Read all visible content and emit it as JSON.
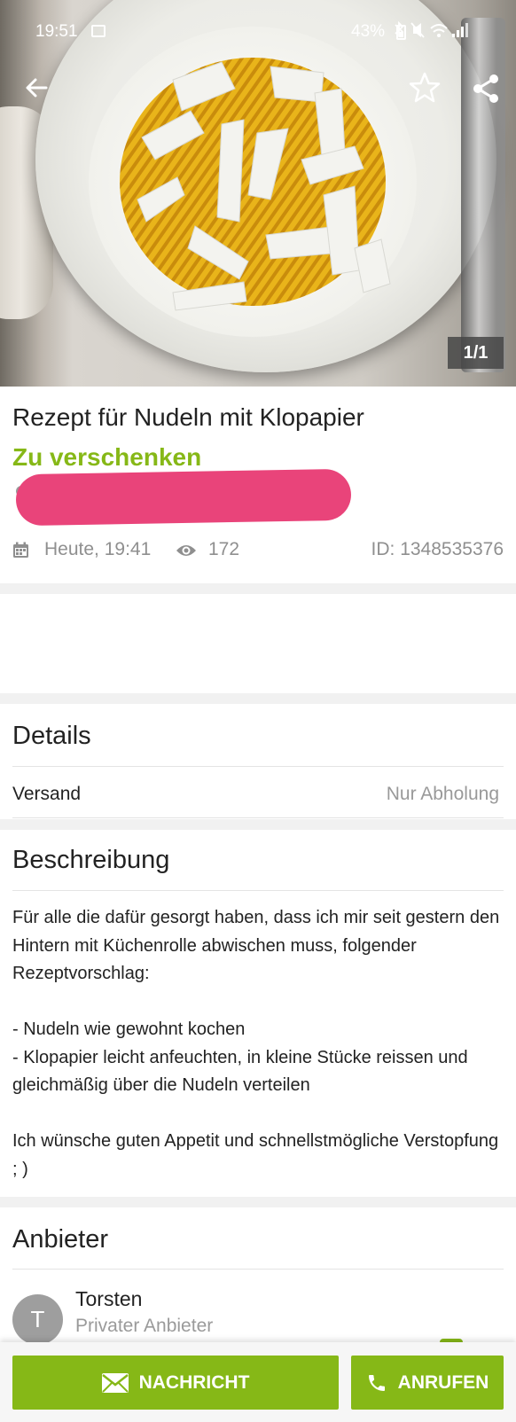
{
  "status_bar": {
    "time": "19:51",
    "battery": "43%"
  },
  "gallery": {
    "counter": "1/1"
  },
  "listing": {
    "title": "Rezept für Nudeln mit Klopapier",
    "price": "Zu verschenken",
    "date": "Heute, 19:41",
    "views": "172",
    "id": "ID: 1348535376"
  },
  "details": {
    "heading": "Details",
    "rows": [
      {
        "label": "Versand",
        "value": "Nur Abholung"
      }
    ]
  },
  "description": {
    "heading": "Beschreibung",
    "text": "Für alle die dafür gesorgt haben, dass ich mir seit gestern den Hintern mit Küchenrolle abwischen muss, folgender Rezeptvorschlag:\n\n- Nudeln wie gewohnt kochen\n- Klopapier leicht anfeuchten, in kleine Stücke reissen und gleichmäßig über die Nudeln verteilen\n\nIch wünsche guten Appetit und schnellstmögliche Verstopfung ; )"
  },
  "seller": {
    "heading": "Anbieter",
    "initial": "T",
    "name": "Torsten",
    "type": "Privater Anbieter"
  },
  "actions": {
    "message": "NACHRICHT",
    "call": "ANRUFEN"
  },
  "colors": {
    "accent": "#86b817",
    "redaction": "#e9447a"
  },
  "icons": [
    "back-arrow-icon",
    "star-icon",
    "share-icon",
    "calendar-icon",
    "eye-icon",
    "envelope-icon",
    "phone-icon"
  ]
}
